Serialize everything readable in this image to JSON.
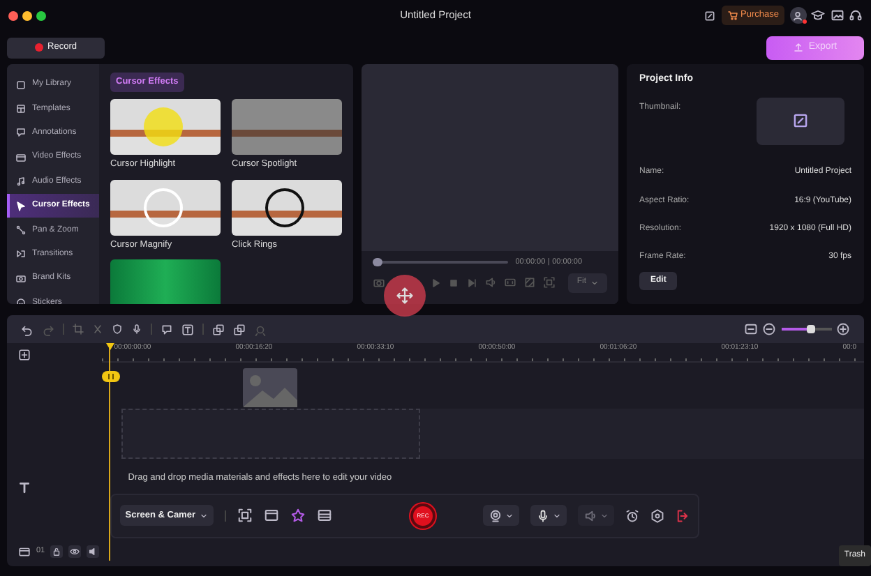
{
  "window": {
    "title": "Untitled Project"
  },
  "header": {
    "purchase": "Purchase",
    "record": "Record",
    "export": "Export"
  },
  "sidebar": [
    {
      "label": "My Library",
      "selected": false
    },
    {
      "label": "Templates",
      "selected": false
    },
    {
      "label": "Annotations",
      "selected": false
    },
    {
      "label": "Video Effects",
      "selected": false
    },
    {
      "label": "Audio Effects",
      "selected": false
    },
    {
      "label": "Cursor Effects",
      "selected": true
    },
    {
      "label": "Pan & Zoom",
      "selected": false
    },
    {
      "label": "Transitions",
      "selected": false
    },
    {
      "label": "Brand Kits",
      "selected": false
    },
    {
      "label": "Stickers",
      "selected": false
    }
  ],
  "effects": {
    "title": "Cursor Effects",
    "items": [
      {
        "kind": "highlight",
        "label": "Cursor Highlight"
      },
      {
        "kind": "spotlight",
        "label": "Cursor Spotlight"
      },
      {
        "kind": "magnify",
        "label": "Cursor Magnify"
      },
      {
        "kind": "rings",
        "label": "Click Rings"
      },
      {
        "kind": "green"
      }
    ]
  },
  "preview": {
    "level": 0,
    "current_time": "00:00:00",
    "separator": "|",
    "total_time": "00:00:00",
    "fit": "Fit"
  },
  "project_info": {
    "title": "Project Info",
    "thumbnail_label": "Thumbnail:",
    "fields": [
      {
        "label": "Name:",
        "value": "Untitled Project"
      },
      {
        "label": "Aspect Ratio:",
        "value": "16:9 (YouTube)"
      },
      {
        "label": "Resolution:",
        "value": "1920 x 1080 (Full HD)"
      },
      {
        "label": "Frame Rate:",
        "value": "30 fps"
      }
    ],
    "edit": "Edit"
  },
  "timeline": {
    "ruler": [
      "00:00:00:00",
      "00:00:16:20",
      "00:00:33:10",
      "00:00:50:00",
      "00:01:06:20",
      "00:01:23:10",
      "00:0"
    ],
    "zoom": {
      "level": 0.6
    },
    "drop_hint": "Drag and drop media materials and effects here to edit your video",
    "track_number": "01"
  },
  "recorder": {
    "source": "Screen & Camer",
    "rec": "REC"
  },
  "tooltip": "Trash"
}
